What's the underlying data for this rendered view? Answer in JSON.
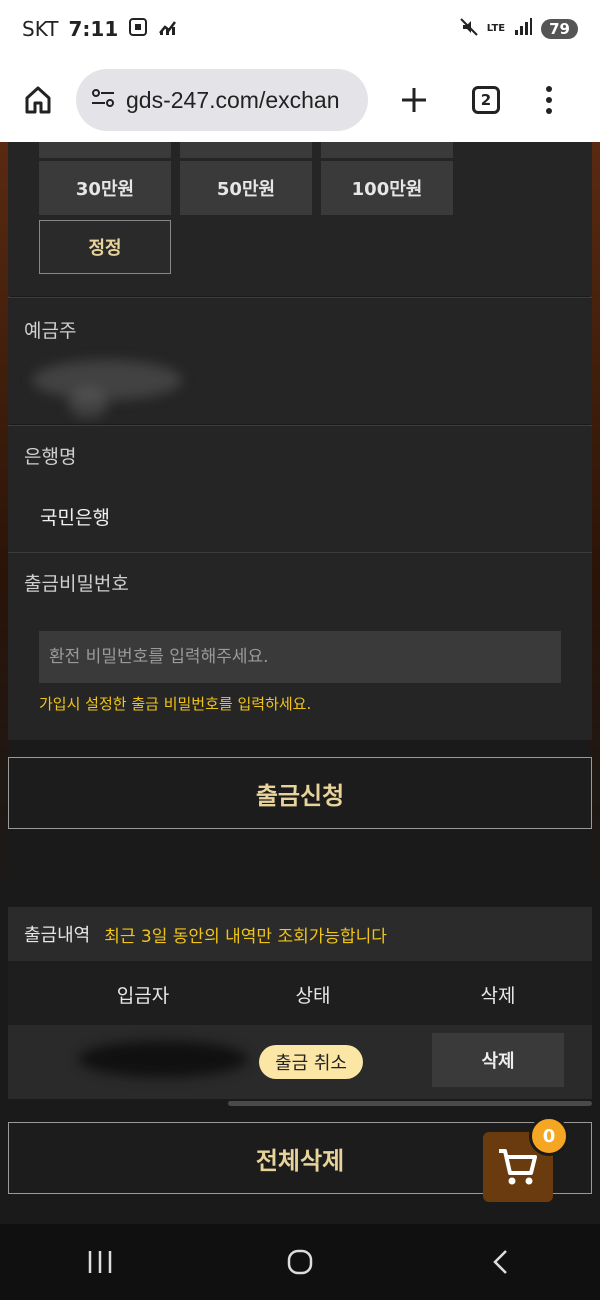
{
  "status_bar": {
    "carrier": "SKT",
    "time": "7:11",
    "network": "LTE",
    "battery": "79"
  },
  "browser": {
    "url": "gds-247.com/exchan",
    "tab_count": "2"
  },
  "amounts": {
    "buttons": [
      "30만원",
      "50만원",
      "100만원"
    ],
    "correct_label": "정정"
  },
  "account_holder": {
    "label": "예금주"
  },
  "bank": {
    "label": "은행명",
    "value": "국민은행"
  },
  "withdraw_password": {
    "label": "출금비밀번호",
    "placeholder": "환전 비밀번호를 입력해주세요.",
    "hint": "가입시 설정한 출금 비밀번호를 입력하세요."
  },
  "submit_label": "출금신청",
  "history": {
    "title": "출금내역",
    "note": "최근 3일 동안의 내역만 조회가능합니다",
    "columns": [
      "입금자",
      "상태",
      "삭제"
    ],
    "rows": [
      {
        "status": "출금 취소",
        "action": "삭제"
      }
    ]
  },
  "delete_all_label": "전체삭제",
  "cart": {
    "count": "0"
  },
  "colors": {
    "accent_gold": "#e8d49a",
    "hint_yellow": "#f0c419",
    "status_pill": "#fbe6a6",
    "cart_bg": "#6a3b0e",
    "badge": "#f5a623"
  }
}
